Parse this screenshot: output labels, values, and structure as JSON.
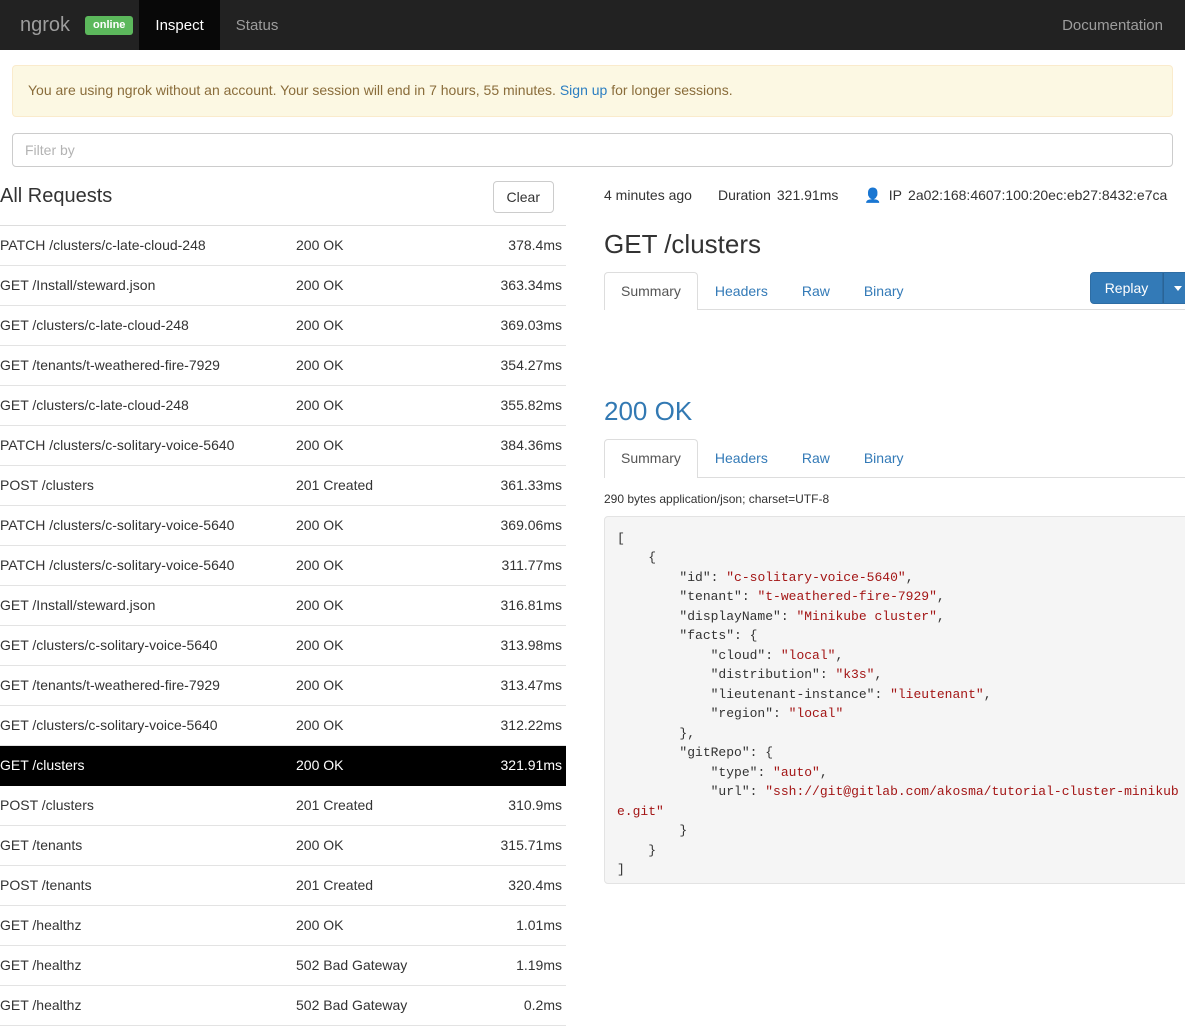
{
  "navbar": {
    "brand": "ngrok",
    "badge": "online",
    "links": [
      {
        "label": "Inspect",
        "active": true
      },
      {
        "label": "Status",
        "active": false
      }
    ],
    "right_label": "Documentation"
  },
  "alert": {
    "text_before": "You are using ngrok without an account. Your session will end in 7 hours, 55 minutes. ",
    "link": "Sign up",
    "text_after": " for longer sessions."
  },
  "filter": {
    "placeholder": "Filter by",
    "value": ""
  },
  "list": {
    "title": "All Requests",
    "clear_label": "Clear",
    "rows": [
      {
        "path": "PATCH /clusters/c-late-cloud-248",
        "status": "200 OK",
        "duration": "378.4ms",
        "selected": false
      },
      {
        "path": "GET /Install/steward.json",
        "status": "200 OK",
        "duration": "363.34ms",
        "selected": false
      },
      {
        "path": "GET /clusters/c-late-cloud-248",
        "status": "200 OK",
        "duration": "369.03ms",
        "selected": false
      },
      {
        "path": "GET /tenants/t-weathered-fire-7929",
        "status": "200 OK",
        "duration": "354.27ms",
        "selected": false
      },
      {
        "path": "GET /clusters/c-late-cloud-248",
        "status": "200 OK",
        "duration": "355.82ms",
        "selected": false
      },
      {
        "path": "PATCH /clusters/c-solitary-voice-5640",
        "status": "200 OK",
        "duration": "384.36ms",
        "selected": false
      },
      {
        "path": "POST /clusters",
        "status": "201 Created",
        "duration": "361.33ms",
        "selected": false
      },
      {
        "path": "PATCH /clusters/c-solitary-voice-5640",
        "status": "200 OK",
        "duration": "369.06ms",
        "selected": false
      },
      {
        "path": "PATCH /clusters/c-solitary-voice-5640",
        "status": "200 OK",
        "duration": "311.77ms",
        "selected": false
      },
      {
        "path": "GET /Install/steward.json",
        "status": "200 OK",
        "duration": "316.81ms",
        "selected": false
      },
      {
        "path": "GET /clusters/c-solitary-voice-5640",
        "status": "200 OK",
        "duration": "313.98ms",
        "selected": false
      },
      {
        "path": "GET /tenants/t-weathered-fire-7929",
        "status": "200 OK",
        "duration": "313.47ms",
        "selected": false
      },
      {
        "path": "GET /clusters/c-solitary-voice-5640",
        "status": "200 OK",
        "duration": "312.22ms",
        "selected": false
      },
      {
        "path": "GET /clusters",
        "status": "200 OK",
        "duration": "321.91ms",
        "selected": true
      },
      {
        "path": "POST /clusters",
        "status": "201 Created",
        "duration": "310.9ms",
        "selected": false
      },
      {
        "path": "GET /tenants",
        "status": "200 OK",
        "duration": "315.71ms",
        "selected": false
      },
      {
        "path": "POST /tenants",
        "status": "201 Created",
        "duration": "320.4ms",
        "selected": false
      },
      {
        "path": "GET /healthz",
        "status": "200 OK",
        "duration": "1.01ms",
        "selected": false
      },
      {
        "path": "GET /healthz",
        "status": "502 Bad Gateway",
        "duration": "1.19ms",
        "selected": false
      },
      {
        "path": "GET /healthz",
        "status": "502 Bad Gateway",
        "duration": "0.2ms",
        "selected": false
      }
    ]
  },
  "detail": {
    "time_ago": "4 minutes ago",
    "duration_label": "Duration",
    "duration_value": "321.91ms",
    "ip_label": "IP",
    "ip_value": "2a02:168:4607:100:20ec:eb27:8432:e7ca",
    "request": {
      "title": "GET /clusters",
      "tabs": [
        {
          "label": "Summary",
          "active": true
        },
        {
          "label": "Headers",
          "active": false
        },
        {
          "label": "Raw",
          "active": false
        },
        {
          "label": "Binary",
          "active": false
        }
      ],
      "replay_label": "Replay"
    },
    "response": {
      "title": "200 OK",
      "tabs": [
        {
          "label": "Summary",
          "active": true
        },
        {
          "label": "Headers",
          "active": false
        },
        {
          "label": "Raw",
          "active": false
        },
        {
          "label": "Binary",
          "active": false
        }
      ],
      "content_type": "290 bytes application/json; charset=UTF-8",
      "body": "[\n    {\n        \"id\": \"c-solitary-voice-5640\",\n        \"tenant\": \"t-weathered-fire-7929\",\n        \"displayName\": \"Minikube cluster\",\n        \"facts\": {\n            \"cloud\": \"local\",\n            \"distribution\": \"k3s\",\n            \"lieutenant-instance\": \"lieutenant\",\n            \"region\": \"local\"\n        },\n        \"gitRepo\": {\n            \"type\": \"auto\",\n            \"url\": \"ssh://git@gitlab.com/akosma/tutorial-cluster-minikube.git\"\n        }\n    }\n]"
    }
  },
  "colors": {
    "navbar_bg": "#222222",
    "badge_green": "#5cb85c",
    "alert_bg": "#fcf8e3",
    "link_blue": "#337ab7",
    "primary_blue": "#337ab7",
    "selected_row_bg": "#000000",
    "json_string": "#a31515"
  }
}
